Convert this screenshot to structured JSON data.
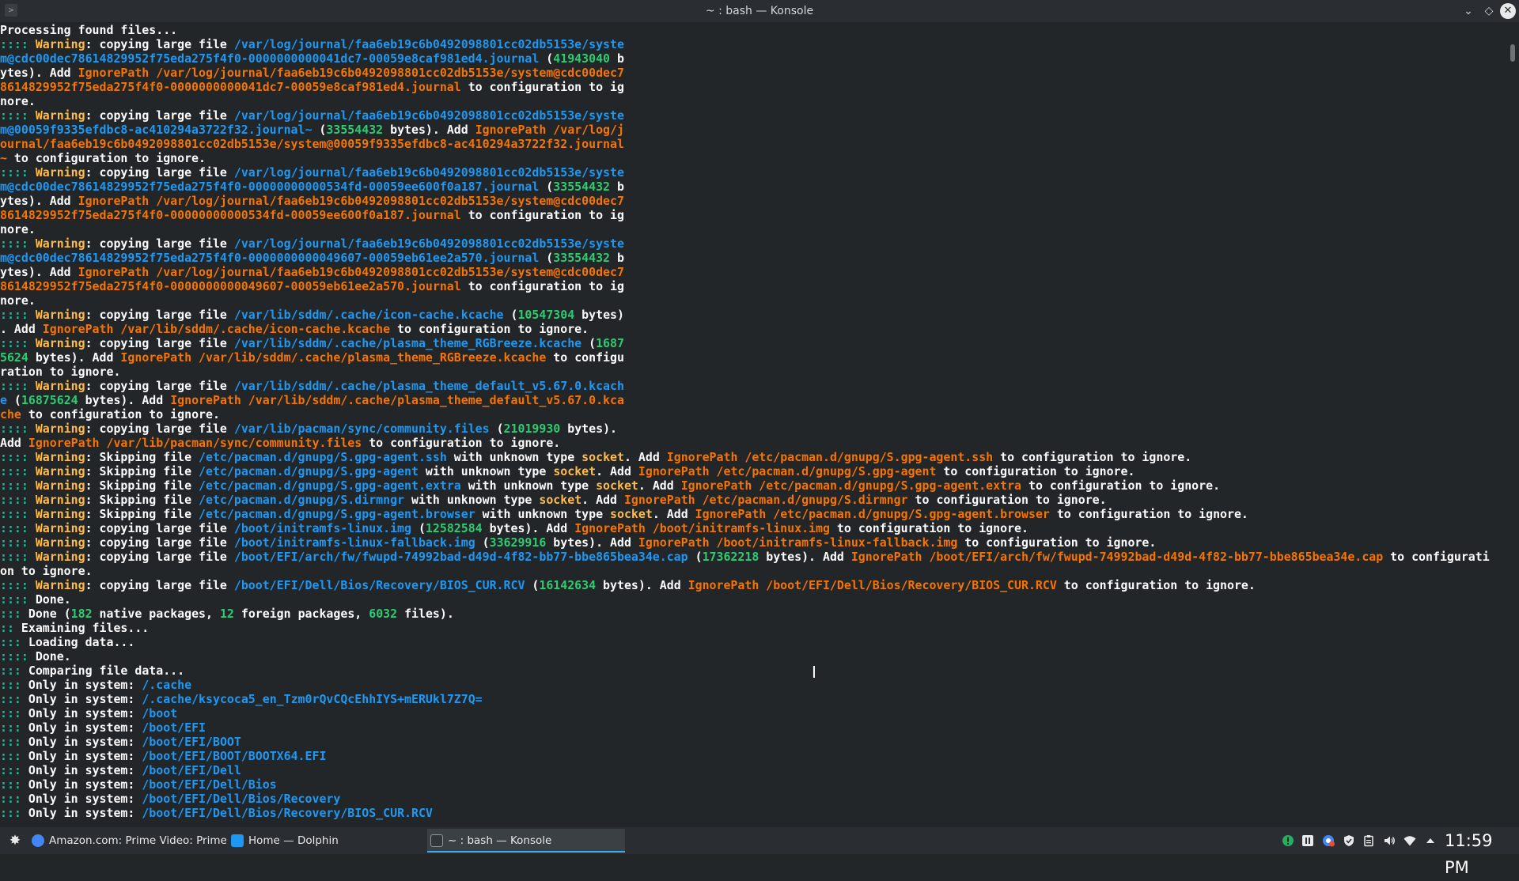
{
  "window": {
    "title": "~ : bash — Konsole"
  },
  "colors": {
    "background": "#232629",
    "text": "#fcfcfc",
    "colon": "#1abc9c",
    "warning": "#fdbc4b",
    "path": "#1d99f3",
    "orange": "#f67400",
    "number": "#2ecc71"
  },
  "terminal": {
    "lines": [
      [
        [
          "t",
          "Processing found files..."
        ]
      ],
      [
        [
          "c",
          ":::: "
        ],
        [
          "w",
          "Warning"
        ],
        [
          "t",
          ": copying large file "
        ],
        [
          "p",
          "/var/log/journal/faa6eb19c6b0492098801cc02db5153e/syste"
        ]
      ],
      [
        [
          "p",
          "m@cdc00dec78614829952f75eda275f4f0-0000000000041dc7-00059e8caf981ed4.journal"
        ],
        [
          "t",
          " ("
        ],
        [
          "g",
          "41943040"
        ],
        [
          "t",
          " b"
        ]
      ],
      [
        [
          "t",
          "ytes). Add "
        ],
        [
          "o",
          "IgnorePath /var/log/journal/faa6eb19c6b0492098801cc02db5153e/system@cdc00dec7"
        ]
      ],
      [
        [
          "o",
          "8614829952f75eda275f4f0-0000000000041dc7-00059e8caf981ed4.journal"
        ],
        [
          "t",
          " to configuration to ig"
        ]
      ],
      [
        [
          "t",
          "nore."
        ]
      ],
      [
        [
          "c",
          ":::: "
        ],
        [
          "w",
          "Warning"
        ],
        [
          "t",
          ": copying large file "
        ],
        [
          "p",
          "/var/log/journal/faa6eb19c6b0492098801cc02db5153e/syste"
        ]
      ],
      [
        [
          "p",
          "m@00059f9335efdbc8-ac410294a3722f32.journal~"
        ],
        [
          "t",
          " ("
        ],
        [
          "g",
          "33554432"
        ],
        [
          "t",
          " bytes). Add "
        ],
        [
          "o",
          "IgnorePath /var/log/j"
        ]
      ],
      [
        [
          "o",
          "ournal/faa6eb19c6b0492098801cc02db5153e/system@00059f9335efdbc8-ac410294a3722f32.journal"
        ]
      ],
      [
        [
          "o",
          "~"
        ],
        [
          "t",
          " to configuration to ignore."
        ]
      ],
      [
        [
          "c",
          ":::: "
        ],
        [
          "w",
          "Warning"
        ],
        [
          "t",
          ": copying large file "
        ],
        [
          "p",
          "/var/log/journal/faa6eb19c6b0492098801cc02db5153e/syste"
        ]
      ],
      [
        [
          "p",
          "m@cdc00dec78614829952f75eda275f4f0-00000000000534fd-00059ee600f0a187.journal"
        ],
        [
          "t",
          " ("
        ],
        [
          "g",
          "33554432"
        ],
        [
          "t",
          " b"
        ]
      ],
      [
        [
          "t",
          "ytes). Add "
        ],
        [
          "o",
          "IgnorePath /var/log/journal/faa6eb19c6b0492098801cc02db5153e/system@cdc00dec7"
        ]
      ],
      [
        [
          "o",
          "8614829952f75eda275f4f0-00000000000534fd-00059ee600f0a187.journal"
        ],
        [
          "t",
          " to configuration to ig"
        ]
      ],
      [
        [
          "t",
          "nore."
        ]
      ],
      [
        [
          "c",
          ":::: "
        ],
        [
          "w",
          "Warning"
        ],
        [
          "t",
          ": copying large file "
        ],
        [
          "p",
          "/var/log/journal/faa6eb19c6b0492098801cc02db5153e/syste"
        ]
      ],
      [
        [
          "p",
          "m@cdc00dec78614829952f75eda275f4f0-0000000000049607-00059eb61ee2a570.journal"
        ],
        [
          "t",
          " ("
        ],
        [
          "g",
          "33554432"
        ],
        [
          "t",
          " b"
        ]
      ],
      [
        [
          "t",
          "ytes). Add "
        ],
        [
          "o",
          "IgnorePath /var/log/journal/faa6eb19c6b0492098801cc02db5153e/system@cdc00dec7"
        ]
      ],
      [
        [
          "o",
          "8614829952f75eda275f4f0-0000000000049607-00059eb61ee2a570.journal"
        ],
        [
          "t",
          " to configuration to ig"
        ]
      ],
      [
        [
          "t",
          "nore."
        ]
      ],
      [
        [
          "c",
          ":::: "
        ],
        [
          "w",
          "Warning"
        ],
        [
          "t",
          ": copying large file "
        ],
        [
          "p",
          "/var/lib/sddm/.cache/icon-cache.kcache"
        ],
        [
          "t",
          " ("
        ],
        [
          "g",
          "10547304"
        ],
        [
          "t",
          " bytes)"
        ]
      ],
      [
        [
          "t",
          ". Add "
        ],
        [
          "o",
          "IgnorePath /var/lib/sddm/.cache/icon-cache.kcache"
        ],
        [
          "t",
          " to configuration to ignore."
        ]
      ],
      [
        [
          "c",
          ":::: "
        ],
        [
          "w",
          "Warning"
        ],
        [
          "t",
          ": copying large file "
        ],
        [
          "p",
          "/var/lib/sddm/.cache/plasma_theme_RGBreeze.kcache"
        ],
        [
          "t",
          " ("
        ],
        [
          "g",
          "1687"
        ]
      ],
      [
        [
          "g",
          "5624"
        ],
        [
          "t",
          " bytes). Add "
        ],
        [
          "o",
          "IgnorePath /var/lib/sddm/.cache/plasma_theme_RGBreeze.kcache"
        ],
        [
          "t",
          " to configu"
        ]
      ],
      [
        [
          "t",
          "ration to ignore."
        ]
      ],
      [
        [
          "c",
          ":::: "
        ],
        [
          "w",
          "Warning"
        ],
        [
          "t",
          ": copying large file "
        ],
        [
          "p",
          "/var/lib/sddm/.cache/plasma_theme_default_v5.67.0.kcach"
        ]
      ],
      [
        [
          "p",
          "e"
        ],
        [
          "t",
          " ("
        ],
        [
          "g",
          "16875624"
        ],
        [
          "t",
          " bytes). Add "
        ],
        [
          "o",
          "IgnorePath /var/lib/sddm/.cache/plasma_theme_default_v5.67.0.kca"
        ]
      ],
      [
        [
          "o",
          "che"
        ],
        [
          "t",
          " to configuration to ignore."
        ]
      ],
      [
        [
          "c",
          ":::: "
        ],
        [
          "w",
          "Warning"
        ],
        [
          "t",
          ": copying large file "
        ],
        [
          "p",
          "/var/lib/pacman/sync/community.files"
        ],
        [
          "t",
          " ("
        ],
        [
          "g",
          "21019930"
        ],
        [
          "t",
          " bytes)."
        ]
      ],
      [
        [
          "t",
          "Add "
        ],
        [
          "o",
          "IgnorePath /var/lib/pacman/sync/community.files"
        ],
        [
          "t",
          " to configuration to ignore."
        ]
      ],
      [
        [
          "c",
          ":::: "
        ],
        [
          "w",
          "Warning"
        ],
        [
          "t",
          ": Skipping file "
        ],
        [
          "p",
          "/etc/pacman.d/gnupg/S.gpg-agent.ssh"
        ],
        [
          "t",
          " with unknown type "
        ],
        [
          "w",
          "socket"
        ],
        [
          "t",
          ". Add "
        ],
        [
          "o",
          "IgnorePath /etc/pacman.d/gnupg/S.gpg-agent.ssh"
        ],
        [
          "t",
          " to configuration to ignore."
        ]
      ],
      [
        [
          "c",
          ":::: "
        ],
        [
          "w",
          "Warning"
        ],
        [
          "t",
          ": Skipping file "
        ],
        [
          "p",
          "/etc/pacman.d/gnupg/S.gpg-agent"
        ],
        [
          "t",
          " with unknown type "
        ],
        [
          "w",
          "socket"
        ],
        [
          "t",
          ". Add "
        ],
        [
          "o",
          "IgnorePath /etc/pacman.d/gnupg/S.gpg-agent"
        ],
        [
          "t",
          " to configuration to ignore."
        ]
      ],
      [
        [
          "c",
          ":::: "
        ],
        [
          "w",
          "Warning"
        ],
        [
          "t",
          ": Skipping file "
        ],
        [
          "p",
          "/etc/pacman.d/gnupg/S.gpg-agent.extra"
        ],
        [
          "t",
          " with unknown type "
        ],
        [
          "w",
          "socket"
        ],
        [
          "t",
          ". Add "
        ],
        [
          "o",
          "IgnorePath /etc/pacman.d/gnupg/S.gpg-agent.extra"
        ],
        [
          "t",
          " to configuration to ignore."
        ]
      ],
      [
        [
          "c",
          ":::: "
        ],
        [
          "w",
          "Warning"
        ],
        [
          "t",
          ": Skipping file "
        ],
        [
          "p",
          "/etc/pacman.d/gnupg/S.dirmngr"
        ],
        [
          "t",
          " with unknown type "
        ],
        [
          "w",
          "socket"
        ],
        [
          "t",
          ". Add "
        ],
        [
          "o",
          "IgnorePath /etc/pacman.d/gnupg/S.dirmngr"
        ],
        [
          "t",
          " to configuration to ignore."
        ]
      ],
      [
        [
          "c",
          ":::: "
        ],
        [
          "w",
          "Warning"
        ],
        [
          "t",
          ": Skipping file "
        ],
        [
          "p",
          "/etc/pacman.d/gnupg/S.gpg-agent.browser"
        ],
        [
          "t",
          " with unknown type "
        ],
        [
          "w",
          "socket"
        ],
        [
          "t",
          ". Add "
        ],
        [
          "o",
          "IgnorePath /etc/pacman.d/gnupg/S.gpg-agent.browser"
        ],
        [
          "t",
          " to configuration to ignore."
        ]
      ],
      [
        [
          "c",
          ":::: "
        ],
        [
          "w",
          "Warning"
        ],
        [
          "t",
          ": copying large file "
        ],
        [
          "p",
          "/boot/initramfs-linux.img"
        ],
        [
          "t",
          " ("
        ],
        [
          "g",
          "12582584"
        ],
        [
          "t",
          " bytes). Add "
        ],
        [
          "o",
          "IgnorePath /boot/initramfs-linux.img"
        ],
        [
          "t",
          " to configuration to ignore."
        ]
      ],
      [
        [
          "c",
          ":::: "
        ],
        [
          "w",
          "Warning"
        ],
        [
          "t",
          ": copying large file "
        ],
        [
          "p",
          "/boot/initramfs-linux-fallback.img"
        ],
        [
          "t",
          " ("
        ],
        [
          "g",
          "33629916"
        ],
        [
          "t",
          " bytes). Add "
        ],
        [
          "o",
          "IgnorePath /boot/initramfs-linux-fallback.img"
        ],
        [
          "t",
          " to configuration to ignore."
        ]
      ],
      [
        [
          "c",
          ":::: "
        ],
        [
          "w",
          "Warning"
        ],
        [
          "t",
          ": copying large file "
        ],
        [
          "p",
          "/boot/EFI/arch/fw/fwupd-74992bad-d49d-4f82-bb77-bbe865bea34e.cap"
        ],
        [
          "t",
          " ("
        ],
        [
          "g",
          "17362218"
        ],
        [
          "t",
          " bytes). Add "
        ],
        [
          "o",
          "IgnorePath /boot/EFI/arch/fw/fwupd-74992bad-d49d-4f82-bb77-bbe865bea34e.cap"
        ],
        [
          "t",
          " to configurati"
        ]
      ],
      [
        [
          "t",
          "on to ignore."
        ]
      ],
      [
        [
          "c",
          ":::: "
        ],
        [
          "w",
          "Warning"
        ],
        [
          "t",
          ": copying large file "
        ],
        [
          "p",
          "/boot/EFI/Dell/Bios/Recovery/BIOS_CUR.RCV"
        ],
        [
          "t",
          " ("
        ],
        [
          "g",
          "16142634"
        ],
        [
          "t",
          " bytes). Add "
        ],
        [
          "o",
          "IgnorePath /boot/EFI/Dell/Bios/Recovery/BIOS_CUR.RCV"
        ],
        [
          "t",
          " to configuration to ignore."
        ]
      ],
      [
        [
          "c",
          ":::: "
        ],
        [
          "t",
          "Done."
        ]
      ],
      [
        [
          "c",
          "::: "
        ],
        [
          "t",
          "Done ("
        ],
        [
          "g",
          "182"
        ],
        [
          "t",
          " native packages, "
        ],
        [
          "g",
          "12"
        ],
        [
          "t",
          " foreign packages, "
        ],
        [
          "g",
          "6032"
        ],
        [
          "t",
          " files)."
        ]
      ],
      [
        [
          "c",
          ":: "
        ],
        [
          "t",
          "Examining files..."
        ]
      ],
      [
        [
          "c",
          "::: "
        ],
        [
          "t",
          "Loading data..."
        ]
      ],
      [
        [
          "c",
          ":::: "
        ],
        [
          "t",
          "Done."
        ]
      ],
      [
        [
          "c",
          "::: "
        ],
        [
          "t",
          "Comparing file data..."
        ]
      ],
      [
        [
          "c",
          "::: "
        ],
        [
          "t",
          "Only in system: "
        ],
        [
          "p",
          "/.cache"
        ]
      ],
      [
        [
          "c",
          "::: "
        ],
        [
          "t",
          "Only in system: "
        ],
        [
          "p",
          "/.cache/ksycoca5_en_Tzm0rQvCQcEhhIYS+mERUkl7Z7Q="
        ]
      ],
      [
        [
          "c",
          "::: "
        ],
        [
          "t",
          "Only in system: "
        ],
        [
          "p",
          "/boot"
        ]
      ],
      [
        [
          "c",
          "::: "
        ],
        [
          "t",
          "Only in system: "
        ],
        [
          "p",
          "/boot/EFI"
        ]
      ],
      [
        [
          "c",
          "::: "
        ],
        [
          "t",
          "Only in system: "
        ],
        [
          "p",
          "/boot/EFI/BOOT"
        ]
      ],
      [
        [
          "c",
          "::: "
        ],
        [
          "t",
          "Only in system: "
        ],
        [
          "p",
          "/boot/EFI/BOOT/BOOTX64.EFI"
        ]
      ],
      [
        [
          "c",
          "::: "
        ],
        [
          "t",
          "Only in system: "
        ],
        [
          "p",
          "/boot/EFI/Dell"
        ]
      ],
      [
        [
          "c",
          "::: "
        ],
        [
          "t",
          "Only in system: "
        ],
        [
          "p",
          "/boot/EFI/Dell/Bios"
        ]
      ],
      [
        [
          "c",
          "::: "
        ],
        [
          "t",
          "Only in system: "
        ],
        [
          "p",
          "/boot/EFI/Dell/Bios/Recovery"
        ]
      ],
      [
        [
          "c",
          "::: "
        ],
        [
          "t",
          "Only in system: "
        ],
        [
          "p",
          "/boot/EFI/Dell/Bios/Recovery/BIOS_CUR.RCV"
        ]
      ]
    ]
  },
  "taskbar": {
    "tasks": [
      {
        "label": "Amazon.com: Prime Video: Prime ...",
        "icon": "chrome-icon"
      },
      {
        "label": "Home — Dolphin",
        "icon": "dolphin-icon"
      },
      {
        "label": "~ : bash — Konsole",
        "icon": "konsole-icon"
      }
    ],
    "tray_icons": [
      "green-status-icon",
      "media-pause-icon",
      "chrome-badge-icon",
      "shield-icon",
      "clipboard-icon",
      "volume-icon",
      "wifi-icon",
      "tray-expand-icon"
    ],
    "clock": "11:59 PM"
  }
}
